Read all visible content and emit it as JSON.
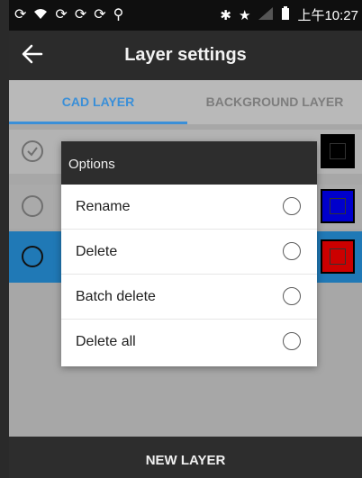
{
  "status_bar": {
    "left_icons": [
      "sync-icon",
      "wifi-icon",
      "sync-icon",
      "sync-icon",
      "sync-icon",
      "usb-icon"
    ],
    "right_icons": [
      "bluetooth-icon",
      "star-icon",
      "signal-icon",
      "battery-icon"
    ],
    "time": "上午10:27"
  },
  "action_bar": {
    "title": "Layer settings",
    "back_icon": "arrow-left-icon"
  },
  "tabs": [
    {
      "label": "CAD LAYER",
      "active": true
    },
    {
      "label": "BACKGROUND LAYER",
      "active": false
    }
  ],
  "layers": [
    {
      "checked": true,
      "color": "#000000"
    },
    {
      "checked": false,
      "color": "#0000cc"
    },
    {
      "checked": false,
      "color": "#cc0000",
      "selected": true
    }
  ],
  "dialog": {
    "title": "Options",
    "options": [
      "Rename",
      "Delete",
      "Batch delete",
      "Delete all"
    ]
  },
  "bottom_button": {
    "label": "NEW LAYER"
  },
  "colors": {
    "accent": "#3a8fd8",
    "selected_row": "#2079b6",
    "toolbar": "#2b2b2b"
  }
}
